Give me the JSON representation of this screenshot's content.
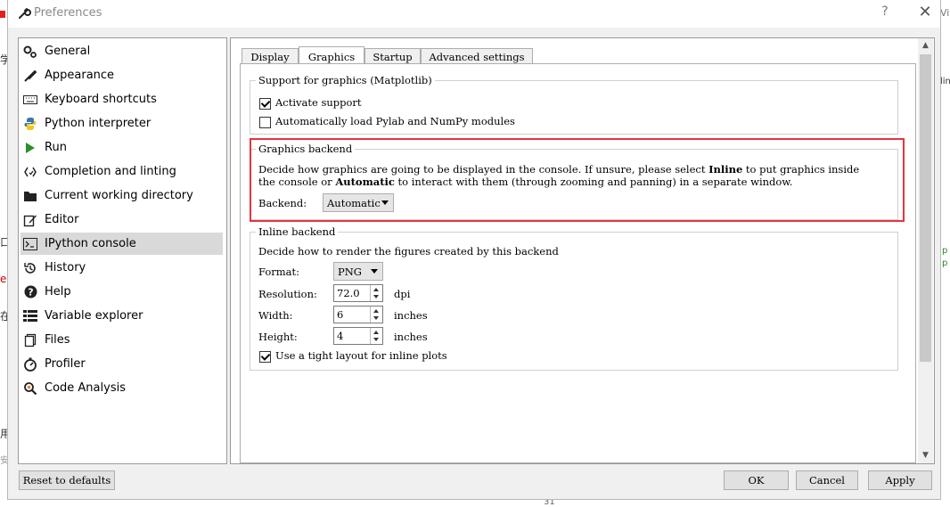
{
  "window": {
    "title": "Preferences",
    "help": "?",
    "close": "✕"
  },
  "background": {
    "left_glyphs": [
      "学",
      "口",
      "e",
      "在",
      "用",
      "安"
    ],
    "right_glyphs": [
      "Vi",
      "lin",
      "p",
      "p"
    ],
    "bottom_number": "31"
  },
  "sidebar": {
    "items": [
      {
        "label": "General",
        "icon": "gears-icon"
      },
      {
        "label": "Appearance",
        "icon": "paint-brush-icon"
      },
      {
        "label": "Keyboard shortcuts",
        "icon": "keyboard-icon"
      },
      {
        "label": "Python interpreter",
        "icon": "python-icon"
      },
      {
        "label": "Run",
        "icon": "play-icon"
      },
      {
        "label": "Completion and linting",
        "icon": "completion-icon"
      },
      {
        "label": "Current working directory",
        "icon": "folder-icon"
      },
      {
        "label": "Editor",
        "icon": "edit-icon"
      },
      {
        "label": "IPython console",
        "icon": "terminal-icon",
        "selected": true
      },
      {
        "label": "History",
        "icon": "history-icon"
      },
      {
        "label": "Help",
        "icon": "question-icon"
      },
      {
        "label": "Variable explorer",
        "icon": "table-icon"
      },
      {
        "label": "Files",
        "icon": "files-icon"
      },
      {
        "label": "Profiler",
        "icon": "profiler-icon"
      },
      {
        "label": "Code Analysis",
        "icon": "code-analysis-icon"
      }
    ]
  },
  "tabs": [
    "Display",
    "Graphics",
    "Startup",
    "Advanced settings"
  ],
  "selected_tab": "Graphics",
  "support_group": {
    "title": "Support for graphics (Matplotlib)",
    "activate": {
      "label": "Activate support",
      "checked": true
    },
    "autoload": {
      "label": "Automatically load Pylab and NumPy modules",
      "checked": false
    }
  },
  "backend_group": {
    "title": "Graphics backend",
    "desc_1a": "Decide how graphics are going to be displayed in the console. If unsure, please select ",
    "desc_1b": "Inline",
    "desc_1c": " to put graphics inside",
    "desc_2a": "the console or ",
    "desc_2b": "Automatic",
    "desc_2c": " to interact with them (through zooming and panning) in a separate window.",
    "backend_label": "Backend:",
    "backend_value": "Automatic"
  },
  "inline_group": {
    "title": "Inline backend",
    "desc": "Decide how to render the figures created by this backend",
    "format_label": "Format:",
    "format_value": "PNG",
    "resolution_label": "Resolution:",
    "resolution_value": "72.0",
    "resolution_unit": "dpi",
    "width_label": "Width:",
    "width_value": "6",
    "width_unit": "inches",
    "height_label": "Height:",
    "height_value": "4",
    "height_unit": "inches",
    "tight": {
      "label": "Use a tight layout for inline plots",
      "checked": true
    }
  },
  "footer": {
    "reset": "Reset to defaults",
    "ok": "OK",
    "cancel": "Cancel",
    "apply": "Apply"
  },
  "colors": {
    "highlight": "#e0373d",
    "selected_item": "#d9d9d9"
  }
}
